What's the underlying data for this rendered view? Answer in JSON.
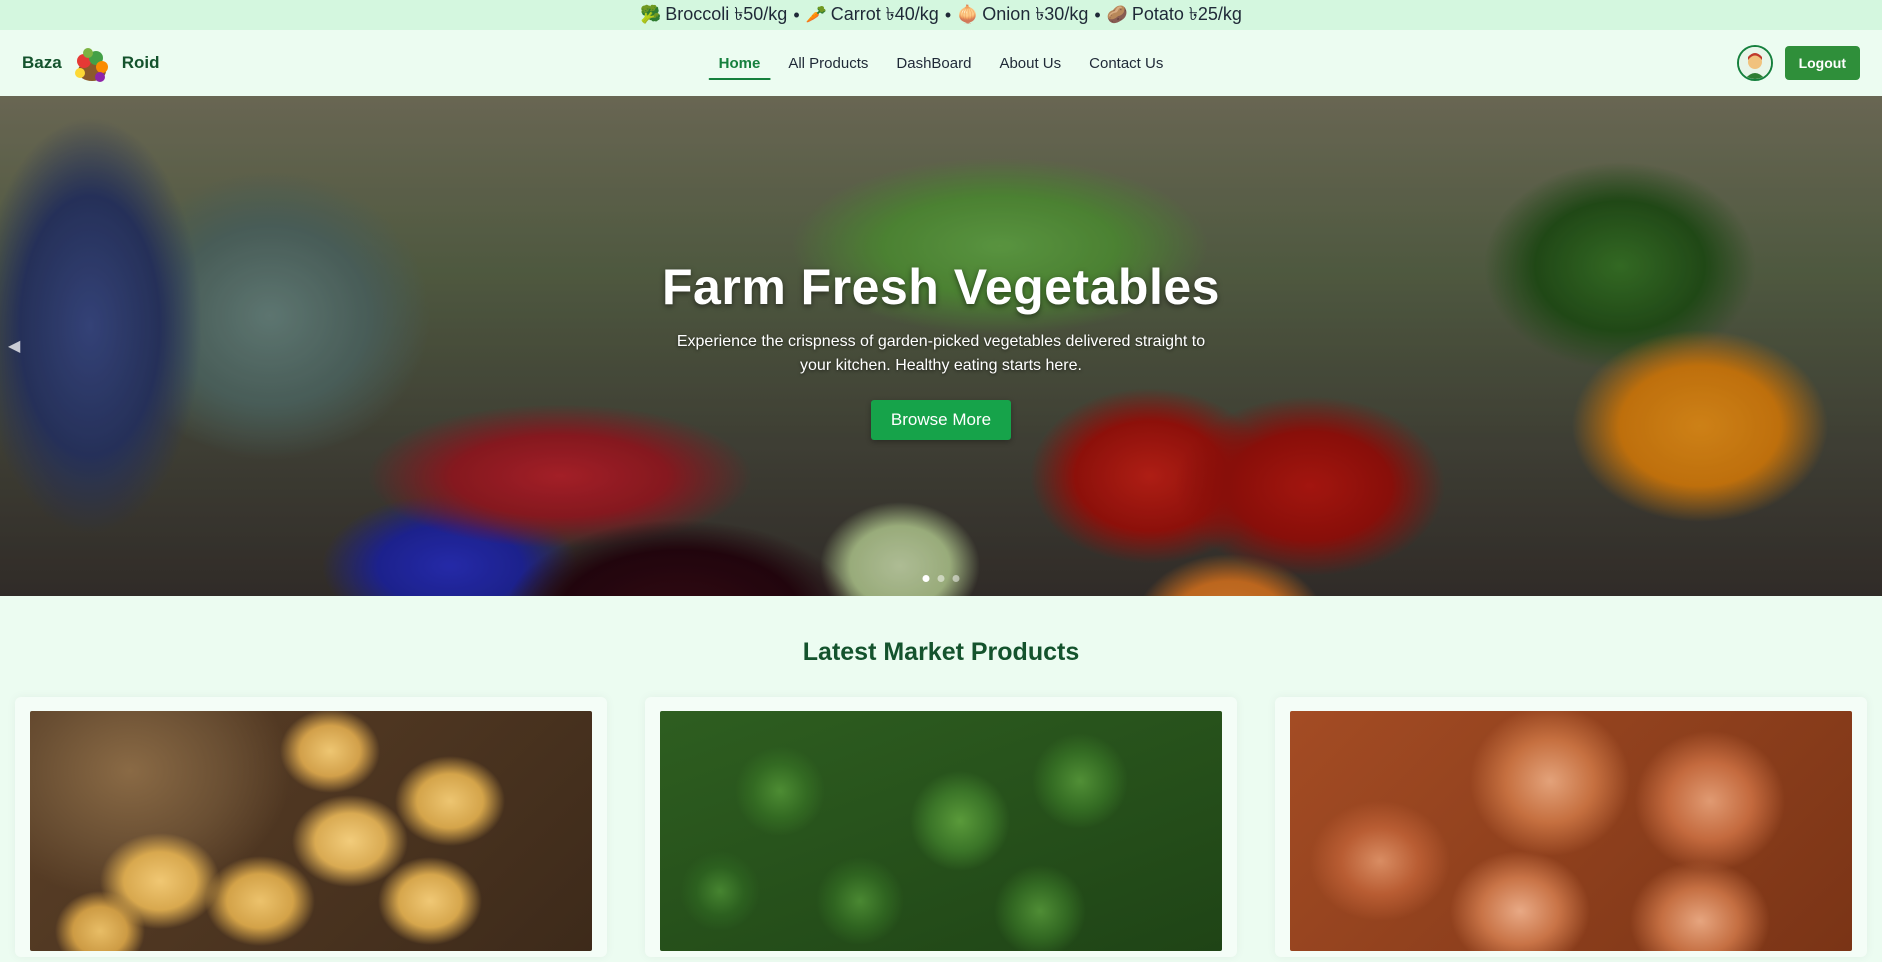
{
  "ticker": {
    "items": [
      {
        "emoji": "🥦",
        "text": "Broccoli ৳50/kg"
      },
      {
        "emoji": "🥕",
        "text": "Carrot ৳40/kg"
      },
      {
        "emoji": "🧅",
        "text": "Onion ৳30/kg"
      },
      {
        "emoji": "🥔",
        "text": "Potato ৳25/kg"
      }
    ],
    "separator": "•"
  },
  "brand": {
    "left": "Baza",
    "right": "Roid"
  },
  "nav": {
    "items": [
      "Home",
      "All Products",
      "DashBoard",
      "About Us",
      "Contact Us"
    ],
    "active": "Home"
  },
  "user": {
    "logout_label": "Logout"
  },
  "hero": {
    "title": "Farm Fresh Vegetables",
    "subtitle": "Experience the crispness of garden-picked vegetables delivered straight to your kitchen. Healthy eating starts here.",
    "button_label": "Browse More",
    "slide_count": 3,
    "active_slide": 1
  },
  "products": {
    "title": "Latest Market Products",
    "items": [
      {
        "image": "potato-image"
      },
      {
        "image": "broccoli-image"
      },
      {
        "image": "onion-image"
      }
    ]
  },
  "colors": {
    "accent": "#15803d",
    "button": "#16a34a",
    "background": "#ecfcf1",
    "ticker_bg": "#d4f7df",
    "heading": "#14532d"
  }
}
